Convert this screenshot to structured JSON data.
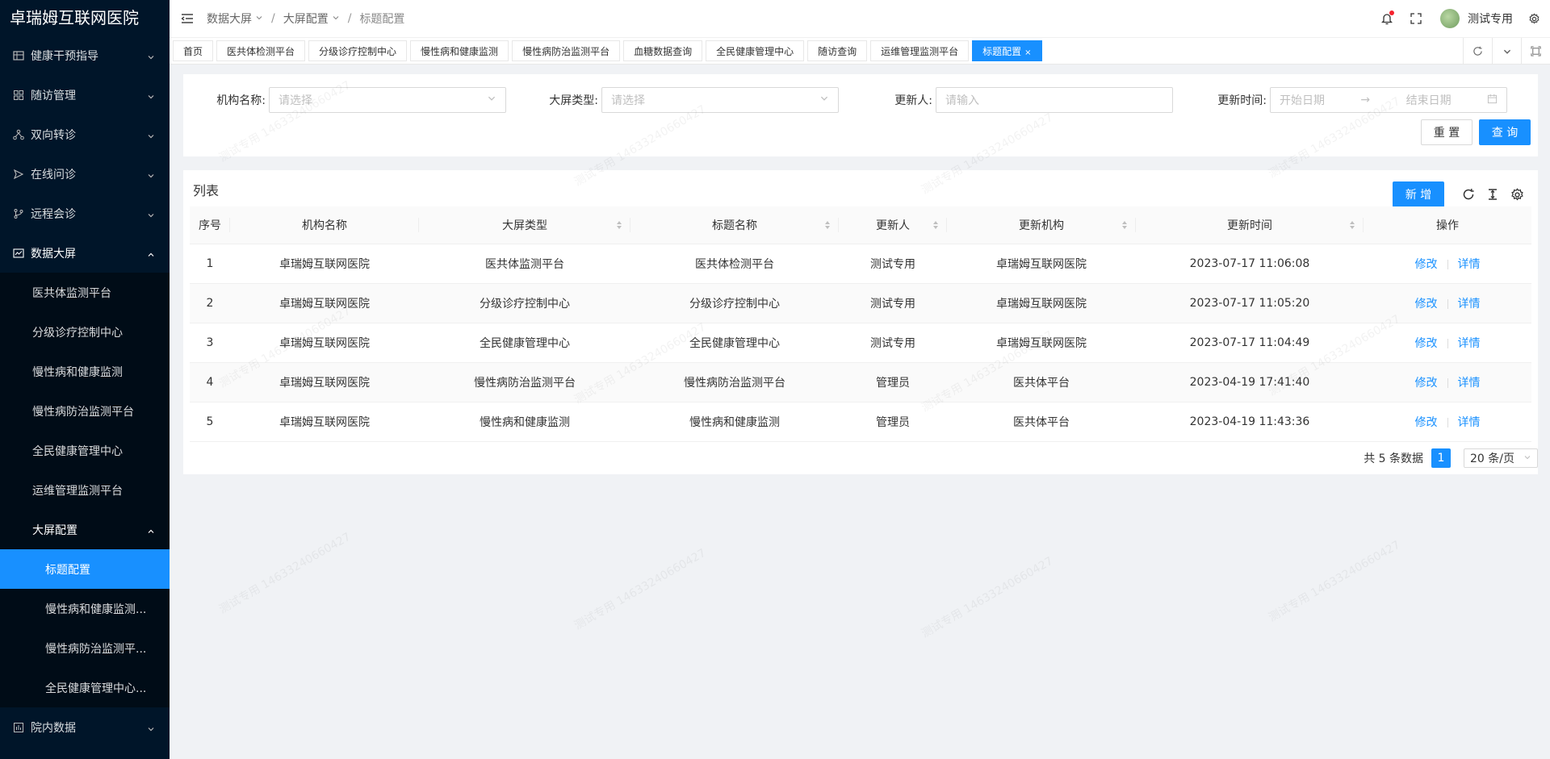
{
  "app": {
    "logo": "卓瑞姆互联网医院"
  },
  "sidebar": {
    "items": [
      {
        "label": "健康干预指导"
      },
      {
        "label": "随访管理"
      },
      {
        "label": "双向转诊"
      },
      {
        "label": "在线问诊"
      },
      {
        "label": "远程会诊"
      },
      {
        "label": "数据大屏"
      },
      {
        "label": "院内数据"
      }
    ],
    "screen_children": [
      {
        "label": "医共体监测平台"
      },
      {
        "label": "分级诊疗控制中心"
      },
      {
        "label": "慢性病和健康监测"
      },
      {
        "label": "慢性病防治监测平台"
      },
      {
        "label": "全民健康管理中心"
      },
      {
        "label": "运维管理监测平台"
      },
      {
        "label": "大屏配置"
      }
    ],
    "config_children": [
      {
        "label": "标题配置"
      },
      {
        "label": "慢性病和健康监测..."
      },
      {
        "label": "慢性病防治监测平..."
      },
      {
        "label": "全民健康管理中心..."
      }
    ]
  },
  "header": {
    "breadcrumb": [
      "数据大屏",
      "大屏配置",
      "标题配置"
    ],
    "sep": "/",
    "username": "测试专用"
  },
  "tabs": [
    {
      "label": "首页"
    },
    {
      "label": "医共体检测平台"
    },
    {
      "label": "分级诊疗控制中心"
    },
    {
      "label": "慢性病和健康监测"
    },
    {
      "label": "慢性病防治监测平台"
    },
    {
      "label": "血糖数据查询"
    },
    {
      "label": "全民健康管理中心"
    },
    {
      "label": "随访查询"
    },
    {
      "label": "运维管理监测平台"
    },
    {
      "label": "标题配置"
    }
  ],
  "tab_close": "×",
  "search": {
    "org_label": "机构名称:",
    "org_placeholder": "请选择",
    "type_label": "大屏类型:",
    "type_placeholder": "请选择",
    "updater_label": "更新人:",
    "updater_placeholder": "请输入",
    "time_label": "更新时间:",
    "start_placeholder": "开始日期",
    "end_placeholder": "结束日期",
    "range_arrow": "→",
    "reset_label": "重 置",
    "query_label": "查 询"
  },
  "list": {
    "title": "列表",
    "add_label": "新 增",
    "columns": [
      "序号",
      "机构名称",
      "大屏类型",
      "标题名称",
      "更新人",
      "更新机构",
      "更新时间",
      "操作"
    ],
    "edit_label": "修改",
    "detail_label": "详情",
    "rows": [
      [
        "1",
        "卓瑞姆互联网医院",
        "医共体监测平台",
        "医共体检测平台",
        "测试专用",
        "卓瑞姆互联网医院",
        "2023-07-17 11:06:08"
      ],
      [
        "2",
        "卓瑞姆互联网医院",
        "分级诊疗控制中心",
        "分级诊疗控制中心",
        "测试专用",
        "卓瑞姆互联网医院",
        "2023-07-17 11:05:20"
      ],
      [
        "3",
        "卓瑞姆互联网医院",
        "全民健康管理中心",
        "全民健康管理中心",
        "测试专用",
        "卓瑞姆互联网医院",
        "2023-07-17 11:04:49"
      ],
      [
        "4",
        "卓瑞姆互联网医院",
        "慢性病防治监测平台",
        "慢性病防治监测平台",
        "管理员",
        "医共体平台",
        "2023-04-19 17:41:40"
      ],
      [
        "5",
        "卓瑞姆互联网医院",
        "慢性病和健康监测",
        "慢性病和健康监测",
        "管理员",
        "医共体平台",
        "2023-04-19 11:43:36"
      ]
    ]
  },
  "pagination": {
    "total_text": "共 5 条数据",
    "current": "1",
    "page_size": "20 条/页"
  },
  "watermark": "测试专用 14633240660427",
  "colors": {
    "primary": "#1890ff",
    "sidebar": "#001529"
  }
}
